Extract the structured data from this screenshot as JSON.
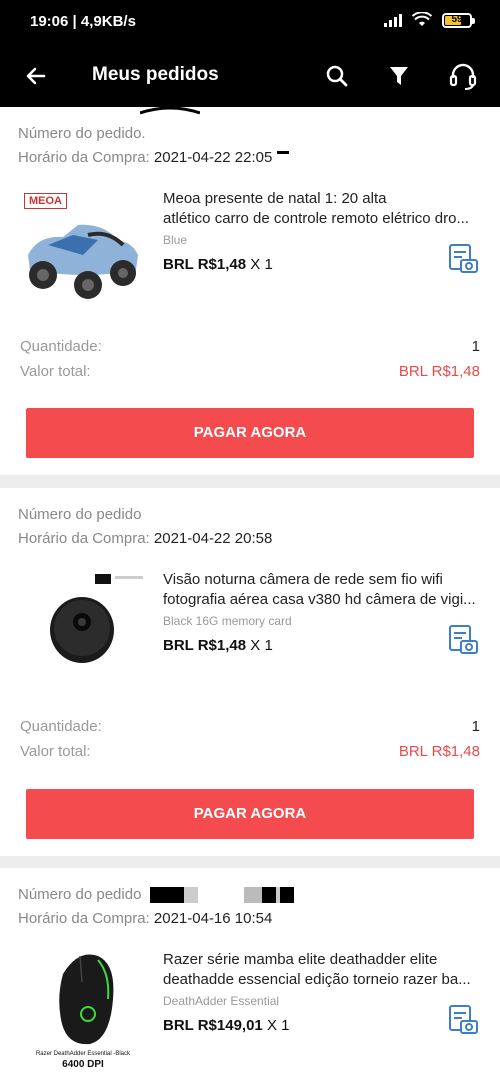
{
  "status": {
    "time": "19:06 | 4,9KB/s",
    "battery": "59"
  },
  "header": {
    "title": "Meus pedidos"
  },
  "labels": {
    "order_number": "Número do pedido.",
    "order_number_plain": "Número do pedido",
    "purchase_time": "Horário da Compra:",
    "quantity": "Quantidade:",
    "total": "Valor total:",
    "pay_button": "PAGAR AGORA"
  },
  "orders": [
    {
      "date": "2021-04-22 22:05",
      "name_line1": "Meoa presente de natal 1: 20 alta",
      "name_line2": "atlético carro de controle remoto elétrico dro...",
      "variant": "Blue",
      "price": "BRL R$1,48",
      "qty_label": "X 1",
      "quantity": "1",
      "total": "BRL R$1,48",
      "brand": "MEOA"
    },
    {
      "date": "2021-04-22 20:58",
      "name_line1": "Visão noturna câmera de rede sem fio wifi",
      "name_line2": "fotografia aérea casa v380 hd câmera de vigi...",
      "variant": "Black  16G memory card",
      "price": "BRL R$1,48",
      "qty_label": "X 1",
      "quantity": "1",
      "total": "BRL R$1,48"
    },
    {
      "date": "2021-04-16 10:54",
      "name_line1": "Razer série mamba elite deathadder elite",
      "name_line2": "deathadde essencial edição torneio razer ba...",
      "variant": "DeathAdder Essential",
      "price": "BRL R$149,01",
      "qty_label": "X 1",
      "thumb_caption": "Razer DeathAdder Essential -Black",
      "thumb_dpi": "6400 DPI"
    }
  ],
  "colors": {
    "accent": "#f44c4e",
    "price_red": "#e84a4a",
    "icon_blue": "#3d7ec7"
  }
}
